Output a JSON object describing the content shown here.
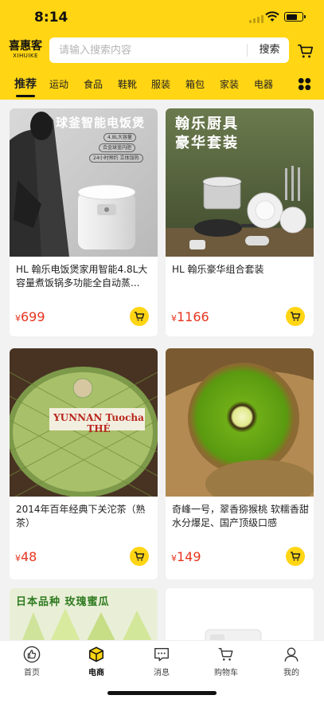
{
  "status": {
    "time": "8:14"
  },
  "brand": {
    "name_zh": "喜惠客",
    "name_en": "XIHUIKE"
  },
  "search": {
    "placeholder": "请输入搜索内容",
    "button": "搜索"
  },
  "tabs": [
    {
      "label": "推荐",
      "active": true
    },
    {
      "label": "运动"
    },
    {
      "label": "食品"
    },
    {
      "label": "鞋靴"
    },
    {
      "label": "服装"
    },
    {
      "label": "箱包"
    },
    {
      "label": "家装"
    },
    {
      "label": "电器"
    }
  ],
  "products": [
    {
      "banner_text": "球釜智能电饭煲",
      "tags": [
        "4.8L大容量",
        "合金球釜内胆",
        "24小时预约 立体加热"
      ],
      "name": "HL 翰乐电饭煲家用智能4.8L大容量煮饭锅多功能全自动蒸...",
      "currency": "¥",
      "price": "699"
    },
    {
      "banner_text": "翰乐厨具\n豪华套装",
      "name": "HL 翰乐豪华组合套装",
      "currency": "¥",
      "price": "1166"
    },
    {
      "banner_text": "YUNNAN Tuocha THÉ",
      "name": "2014年百年经典下关沱茶（熟茶）",
      "currency": "¥",
      "price": "48"
    },
    {
      "name": "奇峰一号，翠香猕猴桃 软糯香甜 水分爆足、国产顶级口感",
      "currency": "¥",
      "price": "149"
    },
    {
      "banner_text": "日本品种 玫瑰蜜瓜"
    },
    {}
  ],
  "bottom_nav": [
    {
      "label": "首页",
      "icon": "thumbs-up-icon"
    },
    {
      "label": "电商",
      "icon": "box-icon",
      "active": true
    },
    {
      "label": "消息",
      "icon": "message-icon"
    },
    {
      "label": "购物车",
      "icon": "cart-icon"
    },
    {
      "label": "我的",
      "icon": "user-icon"
    }
  ],
  "colors": {
    "brand_yellow": "#ffd514",
    "price_red": "#e6341f"
  }
}
